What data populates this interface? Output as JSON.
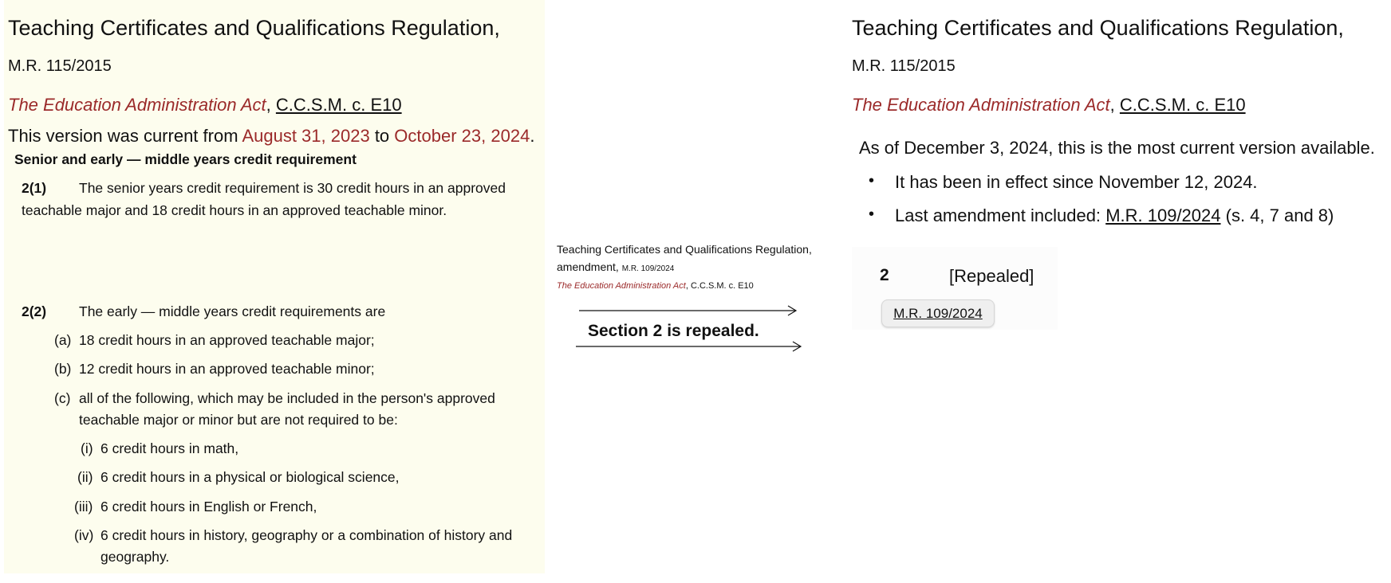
{
  "left": {
    "title": "Teaching Certificates and Qualifications Regulation,",
    "reg_number": "M.R. 115/2015",
    "act_name": "The Education Administration Act",
    "act_sep": ",",
    "act_citation": "C.C.S.M. c. E10",
    "version_prefix": "This version was current from",
    "version_from": "August 31, 2023",
    "version_to_word": "to",
    "version_to": "October 23, 2024",
    "version_end": ".",
    "section_heading": "Senior and early — middle years credit requirement",
    "s2_1_num": "2(1)",
    "s2_1_text_line1": "The senior years credit requirement is 30 credit hours in an approved",
    "s2_1_text_line2": "teachable major and 18 credit hours in an approved teachable minor.",
    "s2_2_num": "2(2)",
    "s2_2_text": "The early — middle years credit requirements are",
    "items": [
      {
        "label": "(a)",
        "text": "18 credit hours in an approved teachable major;"
      },
      {
        "label": "(b)",
        "text": "12 credit hours in an approved teachable minor;"
      },
      {
        "label": "(c)",
        "text_line1": "all of the following, which may be included in the person's approved",
        "text_line2": "teachable major or minor but are not required to be:"
      }
    ],
    "subitems": [
      {
        "label": "(i)",
        "text": "6 credit hours in math,"
      },
      {
        "label": "(ii)",
        "text": "6 credit hours in a physical or biological science,"
      },
      {
        "label": "(iii)",
        "text": "6 credit hours in English or French,"
      },
      {
        "label": "(iv)",
        "text_line1": "6 credit hours in history, geography or a combination of history and",
        "text_line2": "geography."
      }
    ]
  },
  "middle": {
    "title_line1": "Teaching Certificates and Qualifications Regulation,",
    "title_line2": "amendment,",
    "reg_number": "M.R. 109/2024",
    "act_name": "The Education Administration Act",
    "act_citation": ", C.C.S.M. c. E10",
    "repeal_text": "Section 2 is repealed."
  },
  "right": {
    "title": "Teaching Certificates and Qualifications Regulation,",
    "reg_number": "M.R. 115/2015",
    "act_name": "The Education Administration Act",
    "act_sep": ",",
    "act_citation": "C.C.S.M. c. E10",
    "current_notice": "As of December 3, 2024, this is the most current version available.",
    "bullet1": "It has been in effect since November 12, 2024.",
    "bullet2_prefix": "Last amendment included:",
    "bullet2_link": "M.R. 109/2024",
    "bullet2_suffix": "(s. 4, 7 and 8)",
    "section_num": "2",
    "section_status": "[Repealed]",
    "amend_button": "M.R. 109/2024"
  },
  "colors": {
    "left_bg": "#fdfdee",
    "accent_red": "#9b2a2a"
  }
}
